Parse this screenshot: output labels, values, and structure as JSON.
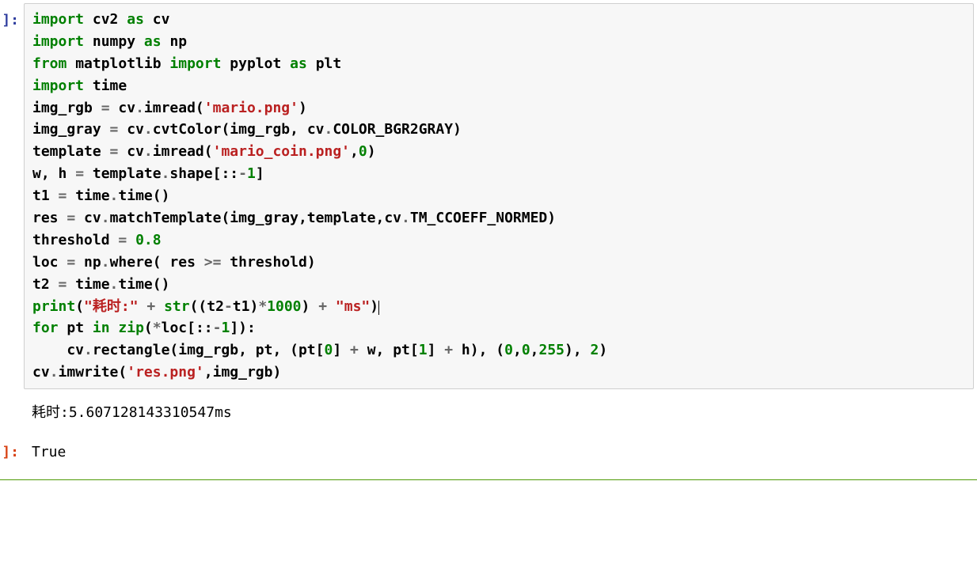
{
  "prompts": {
    "in": "]:",
    "out": "]:"
  },
  "code": {
    "l1_import": "import",
    "l1_cv2": "cv2",
    "l1_as": "as",
    "l1_cv": "cv",
    "l2_import": "import",
    "l2_numpy": "numpy",
    "l2_as": "as",
    "l2_np": "np",
    "l3_from": "from",
    "l3_mpl": "matplotlib",
    "l3_import": "import",
    "l3_pyplot": "pyplot",
    "l3_as": "as",
    "l3_plt": "plt",
    "l4_import": "import",
    "l4_time": "time",
    "l5_a": "img_rgb ",
    "l5_eq": "=",
    "l5_b": " cv",
    "l5_dot1": ".",
    "l5_c": "imread(",
    "l5_str": "'mario.png'",
    "l5_d": ")",
    "l6_a": "img_gray ",
    "l6_eq": "=",
    "l6_b": " cv",
    "l6_dot1": ".",
    "l6_c": "cvtColor(img_rgb, cv",
    "l6_dot2": ".",
    "l6_d": "COLOR_BGR2GRAY)",
    "l7_a": "template ",
    "l7_eq": "=",
    "l7_b": " cv",
    "l7_dot1": ".",
    "l7_c": "imread(",
    "l7_str": "'mario_coin.png'",
    "l7_d": ",",
    "l7_num": "0",
    "l7_e": ")",
    "l8_a": "w, h ",
    "l8_eq": "=",
    "l8_b": " template",
    "l8_dot": ".",
    "l8_c": "shape[::",
    "l8_neg1": "-",
    "l8_1": "1",
    "l8_d": "]",
    "l9_a": "t1 ",
    "l9_eq": "=",
    "l9_b": " time",
    "l9_dot": ".",
    "l9_c": "time()",
    "l10_a": "res ",
    "l10_eq": "=",
    "l10_b": " cv",
    "l10_dot1": ".",
    "l10_c": "matchTemplate(img_gray,template,cv",
    "l10_dot2": ".",
    "l10_d": "TM_CCOEFF_NORMED)",
    "l11_a": "threshold ",
    "l11_eq": "=",
    "l11_sp": " ",
    "l11_num": "0.8",
    "l12_a": "loc ",
    "l12_eq": "=",
    "l12_b": " np",
    "l12_dot": ".",
    "l12_c": "where( res ",
    "l12_ge": ">=",
    "l12_d": " threshold)",
    "l13_a": "t2 ",
    "l13_eq": "=",
    "l13_b": " time",
    "l13_dot": ".",
    "l13_c": "time()",
    "l14_print": "print",
    "l14_a": "(",
    "l14_str1": "\"耗时:\"",
    "l14_sp1": " ",
    "l14_plus1": "+",
    "l14_sp2": " ",
    "l14_str": "str",
    "l14_b": "((t2",
    "l14_minus": "-",
    "l14_c": "t1)",
    "l14_star": "*",
    "l14_num": "1000",
    "l14_d": ") ",
    "l14_plus2": "+",
    "l14_sp3": " ",
    "l14_str2": "\"ms\"",
    "l14_e": ")",
    "l15_for": "for",
    "l15_a": " pt ",
    "l15_in": "in",
    "l15_sp": " ",
    "l15_zip": "zip",
    "l15_b": "(",
    "l15_star": "*",
    "l15_c": "loc[::",
    "l15_neg": "-",
    "l15_1": "1",
    "l15_d": "]):",
    "l16_indent": "    cv",
    "l16_dot": ".",
    "l16_a": "rectangle(img_rgb, pt, (pt[",
    "l16_z0": "0",
    "l16_b": "] ",
    "l16_plus1": "+",
    "l16_c": " w, pt[",
    "l16_z1": "1",
    "l16_d": "] ",
    "l16_plus2": "+",
    "l16_e": " h), (",
    "l16_n0": "0",
    "l16_f": ",",
    "l16_n1": "0",
    "l16_g": ",",
    "l16_n2": "255",
    "l16_h": "), ",
    "l16_n3": "2",
    "l16_i": ")",
    "l17_a": "cv",
    "l17_dot": ".",
    "l17_b": "imwrite(",
    "l17_str": "'res.png'",
    "l17_c": ",img_rgb)"
  },
  "output": {
    "stdout": "耗时:5.607128143310547ms",
    "result": "True"
  }
}
